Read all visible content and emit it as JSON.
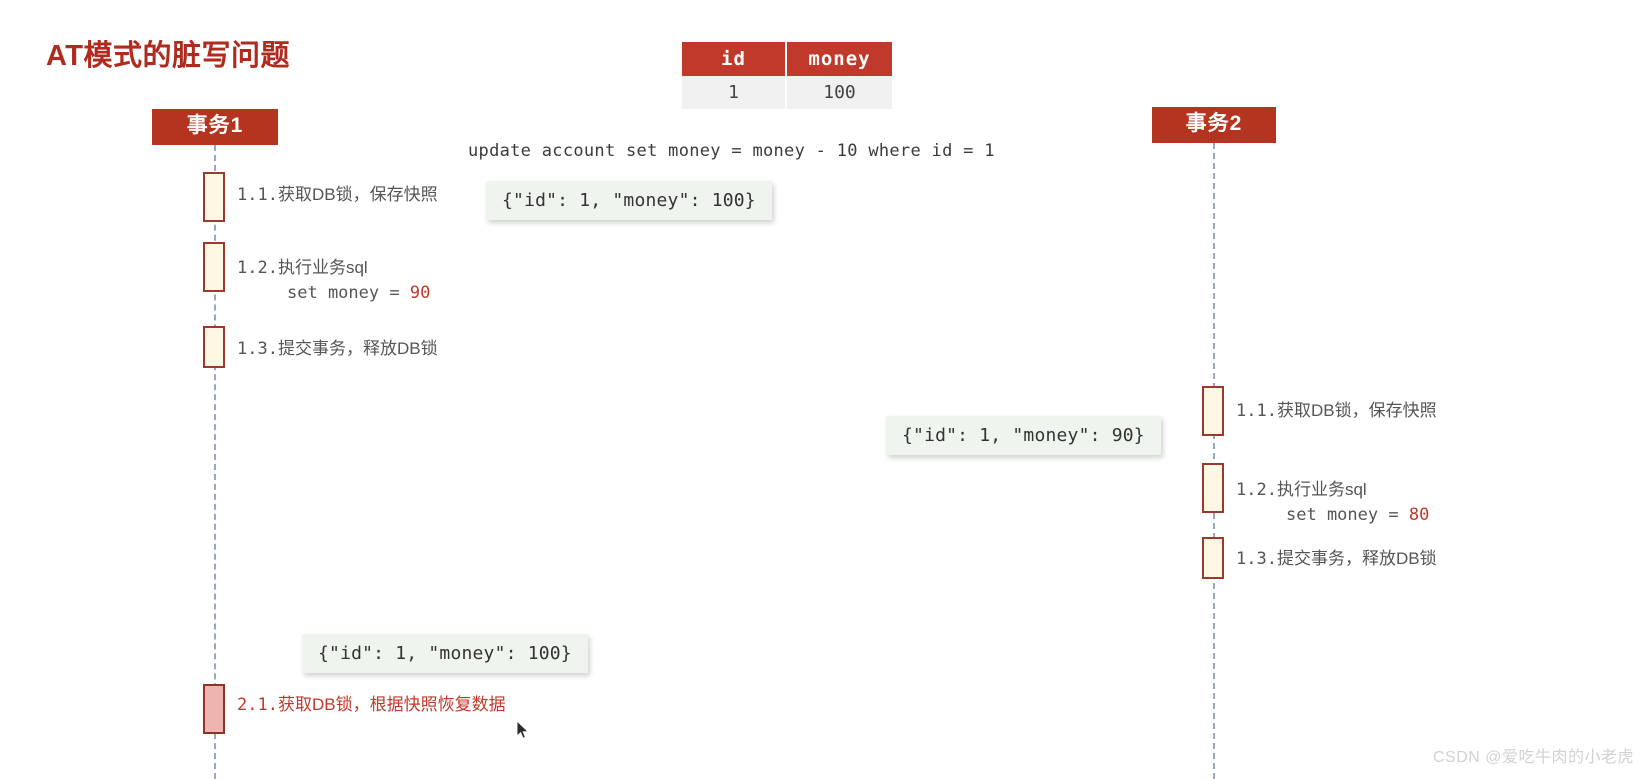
{
  "title": "AT模式的脏写问题",
  "watermark": "CSDN @爱吃牛肉的小老虎",
  "sql_statement": "update account set money = money - 10 where id = 1",
  "table": {
    "headers": [
      "id",
      "money"
    ],
    "rows": [
      [
        "1",
        "100"
      ]
    ]
  },
  "colors": {
    "accent": "#b02a1e",
    "actor_box": "#b5341f",
    "table_header": "#c0392b",
    "activation_fill": "#fdf7e3",
    "activation_border": "#9b3a2c",
    "dirty_fill": "#edb4b0",
    "json_box": "#eff4ef",
    "lifeline": "#9aa7c0",
    "value_highlight": "#c0392b"
  },
  "actors": [
    {
      "id": "tx1",
      "label": "事务1"
    },
    {
      "id": "tx2",
      "label": "事务2"
    }
  ],
  "tx1_steps": [
    {
      "num": "1.1.",
      "text": "获取DB锁，保存快照",
      "sql": ""
    },
    {
      "num": "1.2.",
      "text": "执行业务sql",
      "sql": "set money = ",
      "sql_value": "90"
    },
    {
      "num": "1.3.",
      "text": "提交事务，释放DB锁",
      "sql": ""
    },
    {
      "num": "2.1.",
      "text": "获取DB锁，根据快照恢复数据",
      "sql": ""
    }
  ],
  "tx2_steps": [
    {
      "num": "1.1.",
      "text": "获取DB锁，保存快照",
      "sql": ""
    },
    {
      "num": "1.2.",
      "text": "执行业务sql",
      "sql": "set money = ",
      "sql_value": "80"
    },
    {
      "num": "1.3.",
      "text": "提交事务，释放DB锁",
      "sql": ""
    }
  ],
  "snapshots": [
    {
      "id": "snap-tx1-before",
      "text": "{\"id\": 1, \"money\": 100}"
    },
    {
      "id": "snap-tx2-before",
      "text": "{\"id\": 1, \"money\": 90}"
    },
    {
      "id": "snap-tx1-rollback",
      "text": "{\"id\": 1, \"money\": 100}"
    }
  ]
}
